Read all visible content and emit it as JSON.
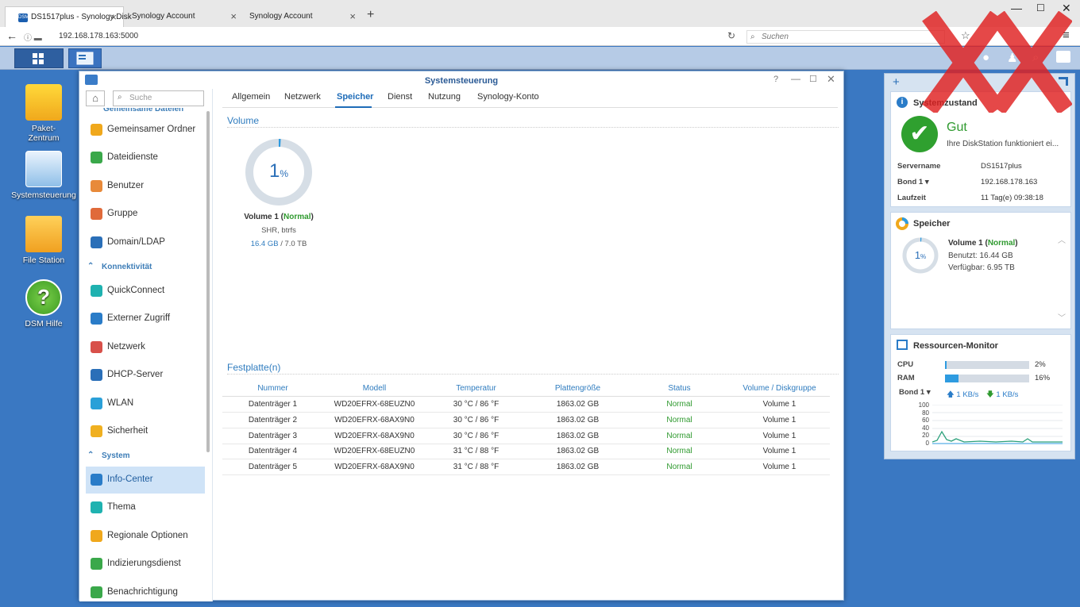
{
  "browser": {
    "tabs": [
      {
        "label": "DS1517plus - Synology Disk"
      },
      {
        "label": "Synology Account"
      },
      {
        "label": "Synology Account"
      }
    ],
    "url": "192.168.178.163:5000",
    "search_placeholder": "Suchen"
  },
  "desktop": {
    "icons": [
      {
        "label": "Paket-\nZentrum"
      },
      {
        "label": "Systemsteuerung"
      },
      {
        "label": "File Station"
      },
      {
        "label": "DSM Hilfe"
      }
    ]
  },
  "window": {
    "title": "Systemsteuerung",
    "search_placeholder": "Suche",
    "sidebar": {
      "cut_item": "Gemeinsame Dateien",
      "items_group1": [
        {
          "label": "Gemeinsamer Ordner",
          "color": "#f0a81c"
        },
        {
          "label": "Dateidienste",
          "color": "#3aa84a"
        },
        {
          "label": "Benutzer",
          "color": "#e88a3a"
        },
        {
          "label": "Gruppe",
          "color": "#e06a3a"
        },
        {
          "label": "Domain/LDAP",
          "color": "#2a6fb8"
        }
      ],
      "section_connectivity": "Konnektivität",
      "items_group2": [
        {
          "label": "QuickConnect",
          "color": "#1fb2b0"
        },
        {
          "label": "Externer Zugriff",
          "color": "#2a7cc8"
        },
        {
          "label": "Netzwerk",
          "color": "#d8504a"
        },
        {
          "label": "DHCP-Server",
          "color": "#2a6fb8"
        },
        {
          "label": "WLAN",
          "color": "#2aa0d8"
        },
        {
          "label": "Sicherheit",
          "color": "#f0b020"
        }
      ],
      "section_system": "System",
      "items_group3": [
        {
          "label": "Info-Center",
          "color": "#2a7cc8"
        },
        {
          "label": "Thema",
          "color": "#1fb2b0"
        },
        {
          "label": "Regionale Optionen",
          "color": "#f0a81c"
        },
        {
          "label": "Indizierungsdienst",
          "color": "#3aa84a"
        },
        {
          "label": "Benachrichtigung",
          "color": "#3aa84a"
        }
      ]
    },
    "tabs": [
      "Allgemein",
      "Netzwerk",
      "Speicher",
      "Dienst",
      "Nutzung",
      "Synology-Konto"
    ],
    "active_tab": "Speicher",
    "volume_section": "Volume",
    "volume": {
      "percent_value": "1",
      "percent_unit": "%",
      "usage_fraction": 0.01,
      "name": "Volume 1",
      "status": "Normal",
      "fs": "SHR, btrfs",
      "used": "16.4 GB",
      "total": "/ 7.0 TB"
    },
    "disks_section": "Festplatte(n)",
    "disk_table": {
      "headers": [
        "Nummer",
        "Modell",
        "Temperatur",
        "Plattengröße",
        "Status",
        "Volume / Diskgruppe"
      ],
      "rows": [
        [
          "Datenträger 1",
          "WD20EFRX-68EUZN0",
          "30 °C / 86 °F",
          "1863.02 GB",
          "Normal",
          "Volume 1"
        ],
        [
          "Datenträger 2",
          "WD20EFRX-68AX9N0",
          "30 °C / 86 °F",
          "1863.02 GB",
          "Normal",
          "Volume 1"
        ],
        [
          "Datenträger 3",
          "WD20EFRX-68AX9N0",
          "30 °C / 86 °F",
          "1863.02 GB",
          "Normal",
          "Volume 1"
        ],
        [
          "Datenträger 4",
          "WD20EFRX-68EUZN0",
          "31 °C / 88 °F",
          "1863.02 GB",
          "Normal",
          "Volume 1"
        ],
        [
          "Datenträger 5",
          "WD20EFRX-68AX9N0",
          "31 °C / 88 °F",
          "1863.02 GB",
          "Normal",
          "Volume 1"
        ]
      ]
    }
  },
  "widgets": {
    "health": {
      "title": "Systemzustand",
      "status": "Gut",
      "message": "Ihre DiskStation funktioniert ei...",
      "server_label": "Servername",
      "server": "DS1517plus",
      "bond_label": "Bond 1",
      "ip": "192.168.178.163",
      "uptime_label": "Laufzeit",
      "uptime": "11 Tag(e) 09:38:18"
    },
    "storage": {
      "title": "Speicher",
      "pct_value": "1",
      "pct_unit": "%",
      "volume": "Volume 1",
      "status": "Normal",
      "used": "Benutzt: 16.44 GB",
      "free": "Verfügbar: 6.95 TB"
    },
    "resource": {
      "title": "Ressourcen-Monitor",
      "cpu_label": "CPU",
      "cpu": "2%",
      "cpu_value": 2,
      "ram_label": "RAM",
      "ram": "16%",
      "ram_value": 16,
      "bond_label": "Bond 1",
      "up": "1 KB/s",
      "down": "1 KB/s",
      "yticks": [
        "100",
        "80",
        "60",
        "40",
        "20",
        "0"
      ]
    }
  }
}
